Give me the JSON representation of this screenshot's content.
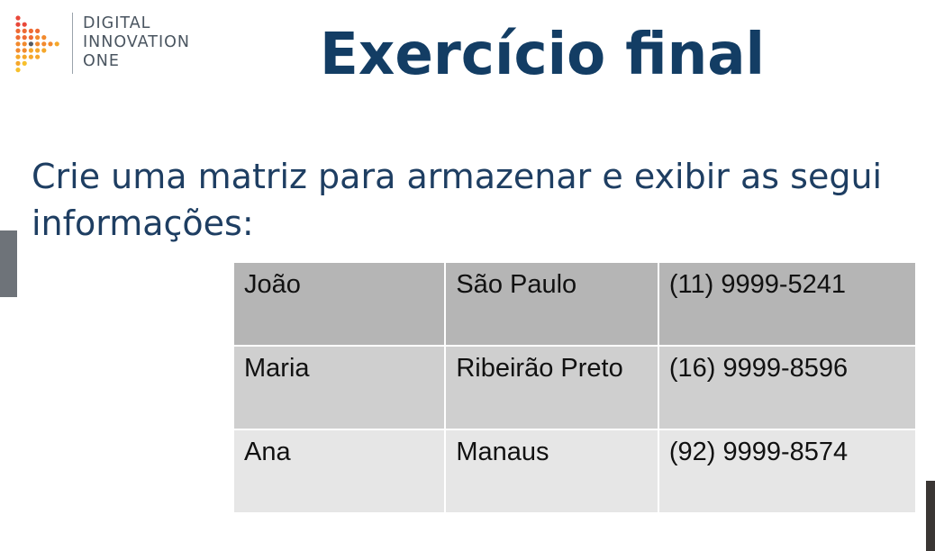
{
  "logo": {
    "lines": [
      "DIGITAL",
      "INNOVATION",
      "ONE"
    ]
  },
  "slide": {
    "title": "Exercício final",
    "prompt_line1": "Crie uma matriz para armazenar e exibir as segui",
    "prompt_line2": "informações:"
  },
  "table": {
    "rows": [
      [
        "João",
        "São Paulo",
        "(11) 9999-5241"
      ],
      [
        "Maria",
        "Ribeirão Preto",
        "(16) 9999-8596"
      ],
      [
        "Ana",
        "Manaus",
        "(92) 9999-8574"
      ]
    ]
  },
  "colors": {
    "title": "#133d64",
    "prompt": "#1e3e62",
    "row_1": "#b5b5b5",
    "row_2": "#cfcfcf",
    "row_3": "#e6e6e6"
  }
}
